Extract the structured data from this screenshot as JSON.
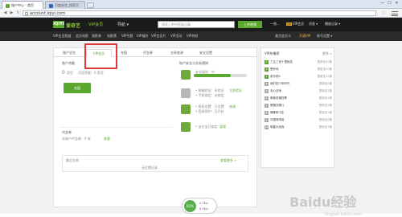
{
  "browser": {
    "tabs": [
      {
        "title": "账户中心 - 首页",
        "icon_color": "#5aa92e"
      },
      {
        "title": "百度经验_搜索页",
        "icon_color": "#2b66c9"
      }
    ],
    "window_controls": [
      "—",
      "☐",
      "✕"
    ],
    "nav_buttons": [
      "◀",
      "▶",
      "↻"
    ],
    "address": "account.iqiyi.com"
  },
  "header": {
    "logo": "iQIYI",
    "brand": "爱奇艺",
    "brand_sub": "· VIP会员",
    "guide": "导航 ▾",
    "search_placeholder": "搜索上的中国身边事",
    "upload_button": "上传视频",
    "right_items": [
      "一夜...",
      "VIP会员",
      "消息 ▾",
      "播放记录 ▾"
    ],
    "vip_badge": "VIP"
  },
  "subnav": {
    "items": [
      "VIP会员频道",
      "会员电影",
      "观影券",
      "电影票",
      "VIP专题",
      "VIP福利",
      "VIP会员片",
      "VIP活动",
      "VIP特权"
    ],
    "right_items": [
      "激活会员卡",
      "开通VIP",
      "帐号设置 ▾"
    ]
  },
  "panel": {
    "tabs": [
      "账户总览",
      "VIP会员",
      "充值",
      "代金券",
      "交易查询",
      "安全设置"
    ],
    "active_tab_index": 1,
    "balance": {
      "title": "账户余额",
      "amount_label": "0",
      "amount_unit": "奇豆",
      "frozen_label": "可用余额：0 奇豆",
      "recharge_button": "充值"
    },
    "coupon": {
      "title": "代金券",
      "desc": "本账户代金券：0 张",
      "link": "查看"
    },
    "security": {
      "title": "账户安全与交易通知",
      "level_label": "安全级别",
      "level_value": "中",
      "progress": 0.7,
      "items": [
        {
          "lines": [
            "• 邮箱验证：未验证",
            "• 手机绑定：未绑定"
          ],
          "link": "立即验证"
        },
        {
          "lines": [
            "• 密码设置：已设置",
            "• 登录保护：已开启"
          ],
          "link": "修改"
        },
        {
          "lines": [
            "• 支付宝已绑定"
          ],
          "link": "管理"
        }
      ]
    },
    "bottom": {
      "title": "最近交易",
      "more_link": "查看更多 »",
      "empty_text": "无近期记录"
    }
  },
  "sidebar": {
    "title": "VIP热播榜",
    "more": "更多 »",
    "items": [
      {
        "rank": "1",
        "title": "三生三世十里桃花",
        "extra": "更新至45集"
      },
      {
        "rank": "2",
        "title": "楚乔传",
        "extra": "更新至20集"
      },
      {
        "rank": "3",
        "title": "欢乐颂2",
        "extra": "更新至10集"
      },
      {
        "rank": "4",
        "title": "我们的少年时代",
        "extra": "更新至8集"
      },
      {
        "rank": "5",
        "title": "无心法师",
        "extra": "更新至3集"
      },
      {
        "rank": "6",
        "title": "奇葩说第四季",
        "extra": "更新至2期"
      },
      {
        "rank": "7",
        "title": "爸爸去哪儿",
        "extra": "更新至5期"
      },
      {
        "rank": "8",
        "title": "偶像练习生",
        "extra": "更新至1期"
      },
      {
        "rank": "9",
        "title": "中国有嘻哈",
        "extra": "更新至6期"
      },
      {
        "rank": "10",
        "title": "明星大侦探",
        "extra": "更新至7期"
      }
    ]
  },
  "watermark": {
    "text": "Baidu经验",
    "sub": "jingyan.baidu.com"
  },
  "network": {
    "percent": "61%",
    "up": "0.1K/s",
    "down": "0.3K/s"
  }
}
